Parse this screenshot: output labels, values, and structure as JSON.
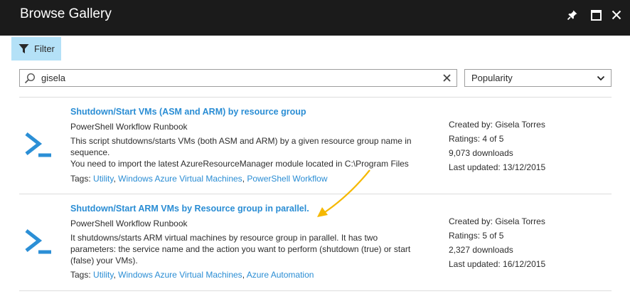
{
  "window": {
    "title": "Browse Gallery"
  },
  "toolbar": {
    "filter_label": "Filter"
  },
  "search": {
    "value": "gisela"
  },
  "sort": {
    "selected": "Popularity"
  },
  "results": [
    {
      "title": "Shutdown/Start VMs (ASM and ARM) by resource group",
      "type": "PowerShell Workflow Runbook",
      "description": [
        "This script shutdowns/starts VMs (both ASM and ARM) by a given resource group name in",
        "sequence.",
        "You need to import the latest AzureResourceManager module located in C:\\Program Files"
      ],
      "tags_label": "Tags:",
      "tags": [
        "Utility",
        "Windows Azure Virtual Machines",
        "PowerShell Workflow"
      ],
      "created_by": "Created by: Gisela Torres",
      "ratings": "Ratings: 4 of 5",
      "downloads": "9,073 downloads",
      "last_updated": "Last updated: 13/12/2015"
    },
    {
      "title": "Shutdown/Start ARM VMs by Resource group in parallel.",
      "type": "PowerShell Workflow Runbook",
      "description": [
        "It shutdowns/starts ARM virtual machines by resource group in parallel. It has two",
        "parameters: the service name and the action you want to perform (shutdown (true) or start",
        "(false) your VMs)."
      ],
      "tags_label": "Tags:",
      "tags": [
        "Utility",
        "Windows Azure Virtual Machines",
        "Azure Automation"
      ],
      "created_by": "Created by: Gisela Torres",
      "ratings": "Ratings: 5 of 5",
      "downloads": "2,327 downloads",
      "last_updated": "Last updated: 16/12/2015"
    }
  ],
  "colors": {
    "titlebar_bg": "#1b1b1b",
    "filter_bg": "#b4e1f7",
    "link": "#2a8dd4",
    "runbook_icon": "#2b8fd6",
    "annotation_arrow": "#f5b800"
  },
  "icons": {
    "pin": "pin-icon",
    "maximize": "maximize-icon",
    "close": "close-icon",
    "filter": "filter-icon",
    "search": "search-icon",
    "clear": "clear-icon",
    "dropdown": "chevron-down-icon",
    "runbook": "powershell-icon"
  }
}
